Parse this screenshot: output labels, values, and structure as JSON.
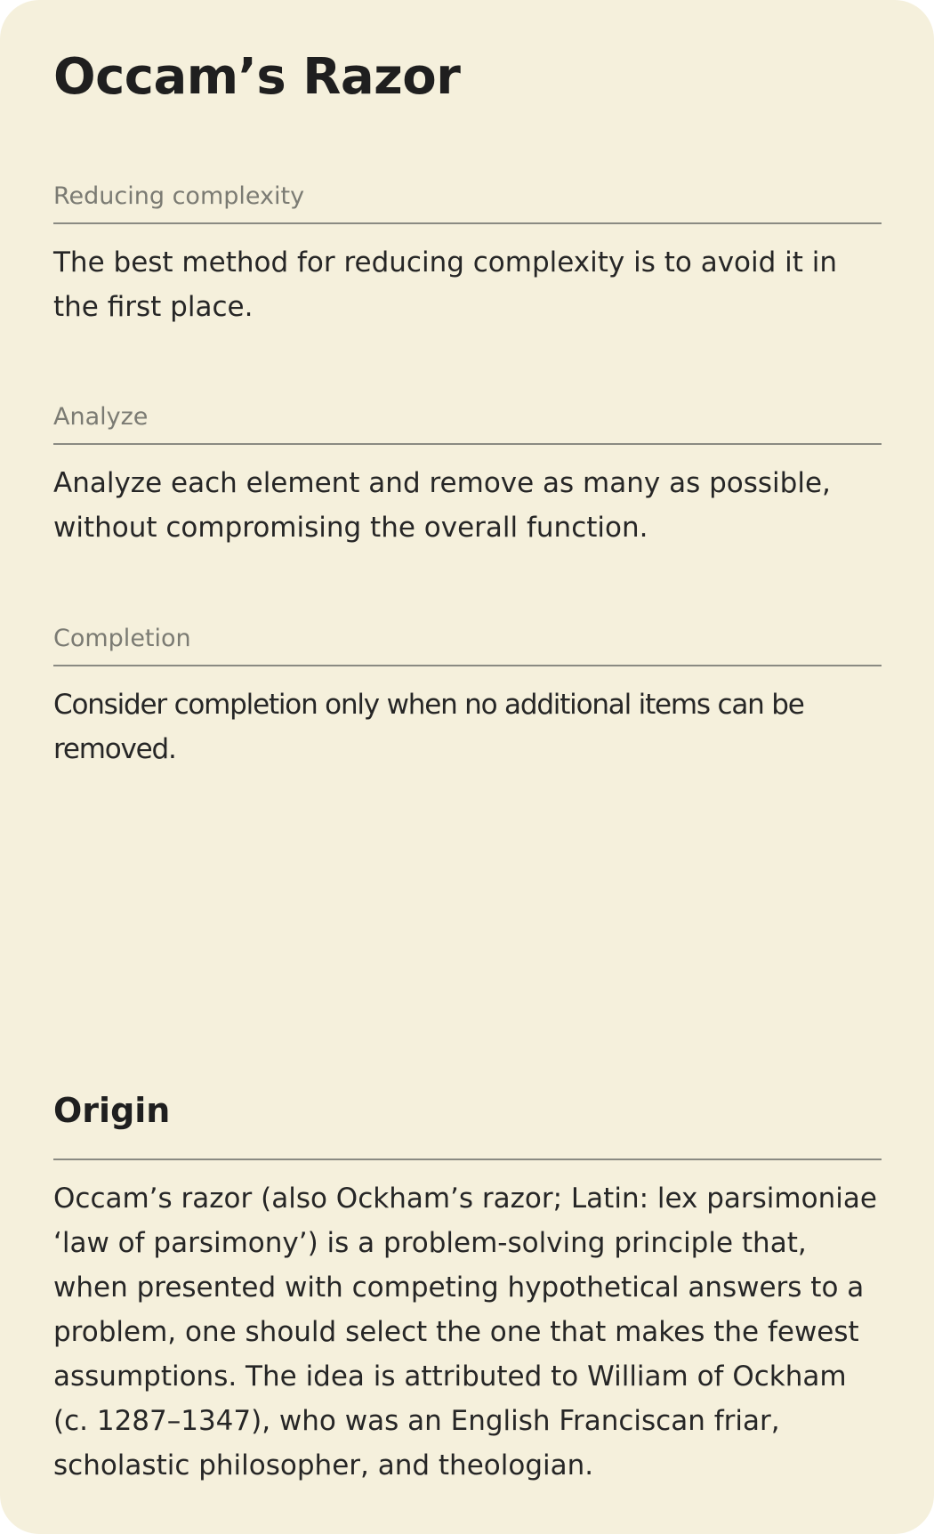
{
  "card": {
    "title": "Occam’s Razor",
    "sections": [
      {
        "label": "Reducing complexity",
        "text": "The best method for reducing complexity is to avoid it in the first place."
      },
      {
        "label": "Analyze",
        "text": "Analyze each element and remove as many as possible, without compromising the overall function."
      },
      {
        "label": "Completion",
        "text": "Consider completion only when no additional items can be removed."
      }
    ],
    "origin": {
      "title": "Origin",
      "text": "Occam’s razor (also Ockham’s razor; Latin: lex parsimoniae ‘law of parsimony’) is a problem-solving principle that, when presented with competing hypothetical answers to a problem, one should select the one that makes the fewest assumptions. The idea is attributed to William of Ockham (c. 1287–1347), who was an English Franciscan friar, scholastic philosopher, and theologian."
    }
  },
  "colors": {
    "background": "#f5f0dc",
    "text": "#262626",
    "label": "#7b7b73",
    "divider": "#8a8a82"
  }
}
